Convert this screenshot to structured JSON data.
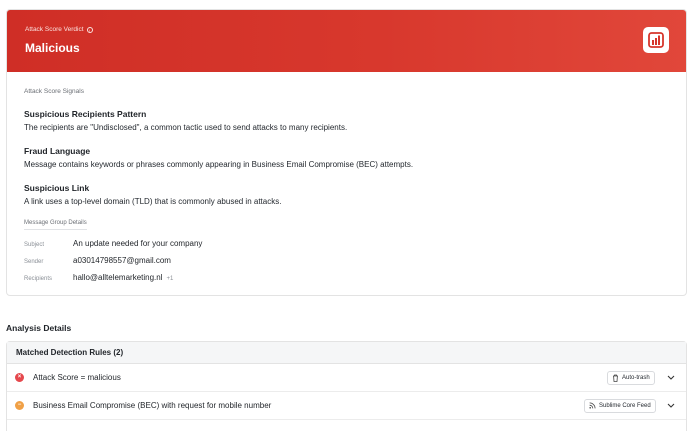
{
  "verdict": {
    "label": "Attack Score Verdict",
    "value": "Malicious",
    "info_icon": "info-icon",
    "badge_icon": "bar-chart-icon",
    "colors": {
      "banner": "#d6352b",
      "badge": "#ffffff"
    }
  },
  "signals": {
    "section_label": "Attack Score Signals",
    "items": [
      {
        "title": "Suspicious Recipients Pattern",
        "description": "The recipients are \"Undisclosed\", a common tactic used to send attacks to many recipients."
      },
      {
        "title": "Fraud Language",
        "description": "Message contains keywords or phrases commonly appearing in Business Email Compromise (BEC) attempts."
      },
      {
        "title": "Suspicious Link",
        "description": "A link uses a top-level domain (TLD) that is commonly abused in attacks."
      }
    ]
  },
  "message_group": {
    "label": "Message Group Details",
    "subject_key": "Subject",
    "subject": "An update needed for your company",
    "sender_key": "Sender",
    "sender": "a03014798557@gmail.com",
    "recipients_key": "Recipients",
    "recipients": "hallo@alltelemarketing.nl",
    "recipients_extra": "+1"
  },
  "analysis": {
    "title": "Analysis Details",
    "rules_header": "Matched Detection Rules (2)",
    "rules": [
      {
        "name": "Attack Score = malicious",
        "status": "malicious",
        "status_color": "#e5484d",
        "action_label": "Auto-trash",
        "action_icon": "trash-icon"
      },
      {
        "name": "Business Email Compromise (BEC) with request for mobile number",
        "status": "suspicious",
        "status_color": "#f0a046",
        "action_label": "Sublime Core Feed",
        "action_icon": "rss-icon"
      }
    ]
  }
}
